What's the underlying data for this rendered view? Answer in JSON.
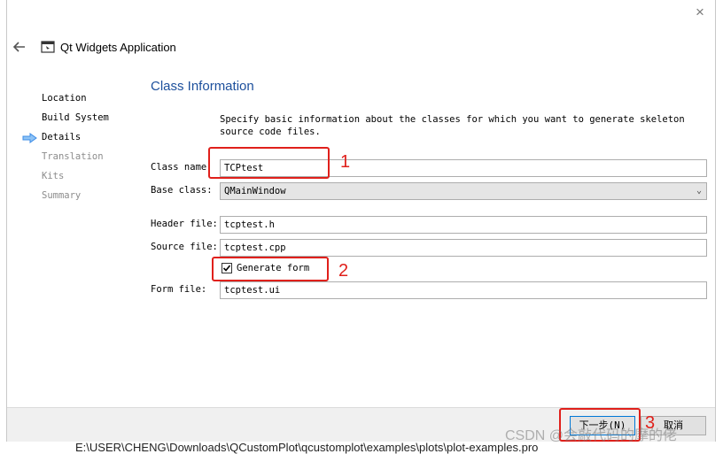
{
  "window": {
    "title": "Qt Widgets Application",
    "close_glyph": "×"
  },
  "sidebar": {
    "items": [
      {
        "label": "Location",
        "state": "done"
      },
      {
        "label": "Build System",
        "state": "done"
      },
      {
        "label": "Details",
        "state": "current"
      },
      {
        "label": "Translation",
        "state": "pending"
      },
      {
        "label": "Kits",
        "state": "pending"
      },
      {
        "label": "Summary",
        "state": "pending"
      }
    ]
  },
  "page": {
    "heading": "Class Information",
    "description": "Specify basic information about the classes for which you want to generate skeleton source code files."
  },
  "form": {
    "class_name": {
      "label": "Class name",
      "value": "TCPtest"
    },
    "base_class": {
      "label": "Base class:",
      "value": "QMainWindow"
    },
    "header_file": {
      "label": "Header file:",
      "value": "tcptest.h"
    },
    "source_file": {
      "label": "Source file:",
      "value": "tcptest.cpp"
    },
    "generate_form": {
      "label": "Generate form",
      "checked": true
    },
    "form_file": {
      "label": "Form file:",
      "value": "tcptest.ui"
    }
  },
  "footer": {
    "next_label": "下一步(N)",
    "cancel_label": "取消"
  },
  "annotations": {
    "marker_1": "1",
    "marker_2": "2",
    "marker_3": "3",
    "color": "#e0201b"
  },
  "background_path": "E:\\USER\\CHENG\\Downloads\\QCustomPlot\\qcustomplot\\examples\\plots\\plot-examples.pro",
  "watermark": "CSDN @会敲代码的摩的佬",
  "colors": {
    "heading": "#1c4f9c",
    "accent_arrow": "#3c8ce7"
  }
}
